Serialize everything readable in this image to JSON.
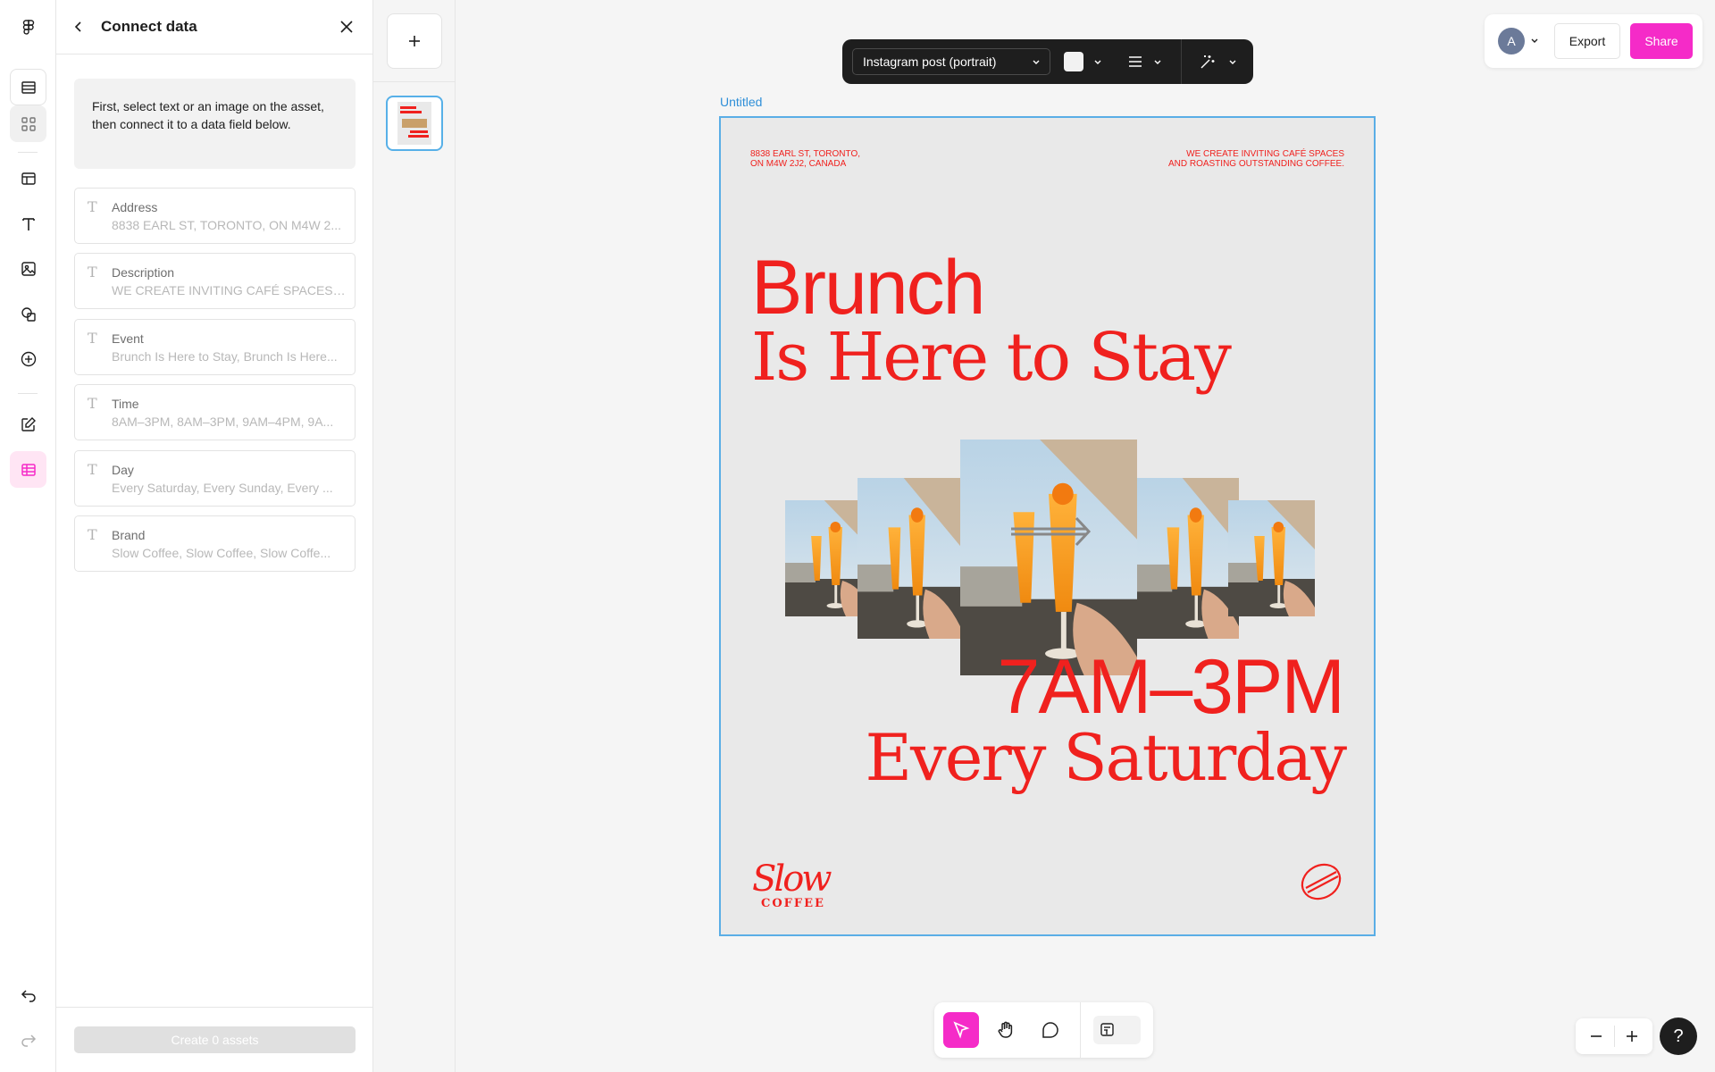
{
  "panel": {
    "title": "Connect data",
    "hint": "First, select text or an image on the asset, then connect it to a data field below.",
    "fields": [
      {
        "label": "Address",
        "value": "8838 EARL ST, TORONTO, ON M4W 2..."
      },
      {
        "label": "Description",
        "value": "WE CREATE INVITING CAFÉ SPACES A..."
      },
      {
        "label": "Event",
        "value": "Brunch Is Here to Stay, Brunch Is Here..."
      },
      {
        "label": "Time",
        "value": "8AM–3PM, 8AM–3PM, 9AM–4PM, 9A..."
      },
      {
        "label": "Day",
        "value": "Every Saturday, Every Sunday, Every ..."
      },
      {
        "label": "Brand",
        "value": "Slow Coffee, Slow Coffee, Slow Coffe..."
      }
    ],
    "create_label": "Create 0 assets"
  },
  "toolbar": {
    "format": "Instagram post (portrait)",
    "swatch_color": "#f2f2f2"
  },
  "header": {
    "avatar_initial": "A",
    "export_label": "Export",
    "share_label": "Share"
  },
  "canvas": {
    "frame_name": "Untitled",
    "address_line1": "8838 EARL ST, TORONTO,",
    "address_line2": "ON M4W 2J2, CANADA",
    "description_line1": "WE CREATE INVITING CAFÉ SPACES",
    "description_line2": "AND ROASTING OUTSTANDING COFFEE.",
    "headline_1": "Brunch",
    "headline_2": "Is Here to Stay",
    "time": "7AM–3PM",
    "day": "Every Saturday",
    "brand_script": "Slow",
    "brand_sub": "COFFEE"
  },
  "help_label": "?",
  "colors": {
    "accent": "#f52bc8",
    "poster_red": "#f0211e",
    "selection_blue": "#5aaee6"
  }
}
